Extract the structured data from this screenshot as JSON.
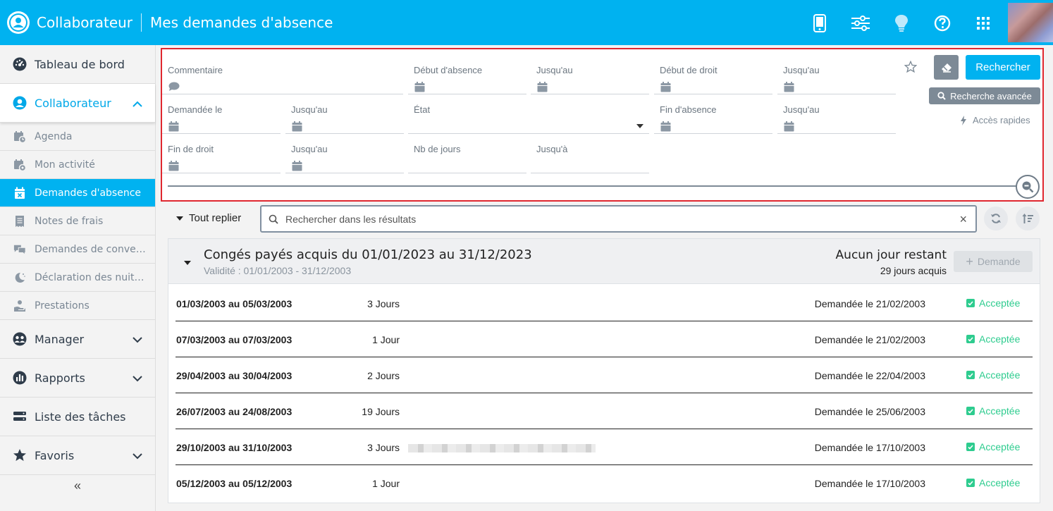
{
  "header": {
    "app_title": "Collaborateur",
    "page_title": "Mes demandes d'absence",
    "icons": [
      "mobile-icon",
      "sliders-icon",
      "lightbulb-icon",
      "help-icon",
      "apps-grid-icon"
    ],
    "accent_color": "#00b2f0"
  },
  "sidebar": {
    "items": [
      {
        "label": "Tableau de bord",
        "icon": "dashboard-icon"
      },
      {
        "label": "Collaborateur",
        "icon": "user-circle-icon",
        "expanded": true
      },
      {
        "label": "Manager",
        "icon": "manager-icon"
      },
      {
        "label": "Rapports",
        "icon": "reports-icon"
      },
      {
        "label": "Liste des tâches",
        "icon": "tasks-icon"
      },
      {
        "label": "Favoris",
        "icon": "star-icon"
      }
    ],
    "sub_items": [
      {
        "label": "Agenda",
        "icon": "calendar-clock-icon"
      },
      {
        "label": "Mon activité",
        "icon": "calendar-activity-icon"
      },
      {
        "label": "Demandes d'absence",
        "icon": "calendar-x-icon",
        "active": true
      },
      {
        "label": "Notes de frais",
        "icon": "receipt-icon"
      },
      {
        "label": "Demandes de convention",
        "icon": "chat-icon"
      },
      {
        "label": "Déclaration des nuitées",
        "icon": "moon-icon"
      },
      {
        "label": "Prestations",
        "icon": "hand-icon"
      }
    ],
    "collapse_label": "«"
  },
  "filters": {
    "commentaire": "Commentaire",
    "debut_absence": "Début d'absence",
    "jusquau_1": "Jusqu'au",
    "debut_droit": "Début de droit",
    "jusquau_2": "Jusqu'au",
    "demandee_le": "Demandée le",
    "jusquau_3": "Jusqu'au",
    "etat": "État",
    "fin_absence": "Fin d'absence",
    "jusquau_4": "Jusqu'au",
    "fin_droit": "Fin de droit",
    "jusquau_5": "Jusqu'au",
    "nb_jours": "Nb de jours",
    "jusqua": "Jusqu'à",
    "search_label": "Rechercher",
    "advanced_label": "Recherche avancée",
    "quick_access_label": "Accès rapides"
  },
  "results": {
    "collapse_all_label": "Tout replier",
    "search_placeholder": "Rechercher dans les résultats",
    "clear_label": "×"
  },
  "group": {
    "title": "Congés payés acquis du 01/01/2023 au 31/12/2023",
    "validity": "Validité : 01/01/2003 - 31/12/2003",
    "remaining": "Aucun jour restant",
    "acquired": "29 jours acquis",
    "demand_label": "Demande",
    "rows": [
      {
        "dates": "01/03/2003 au 05/03/2003",
        "days": "3 Jours",
        "requested": "Demandée le 21/02/2003",
        "status": "Acceptée"
      },
      {
        "dates": "07/03/2003 au 07/03/2003",
        "days": "1 Jour",
        "requested": "Demandée le 21/02/2003",
        "status": "Acceptée"
      },
      {
        "dates": "29/04/2003 au 30/04/2003",
        "days": "2 Jours",
        "requested": "Demandée le 22/04/2003",
        "status": "Acceptée"
      },
      {
        "dates": "26/07/2003 au 24/08/2003",
        "days": "19 Jours",
        "requested": "Demandée le 25/06/2003",
        "status": "Acceptée"
      },
      {
        "dates": "29/10/2003 au 31/10/2003",
        "days": "3 Jours",
        "requested": "Demandée le 17/10/2003",
        "status": "Acceptée",
        "has_comment": true
      },
      {
        "dates": "05/12/2003 au 05/12/2003",
        "days": "1 Jour",
        "requested": "Demandée le 17/10/2003",
        "status": "Acceptée"
      }
    ],
    "status_color": "#2ecc8f"
  }
}
